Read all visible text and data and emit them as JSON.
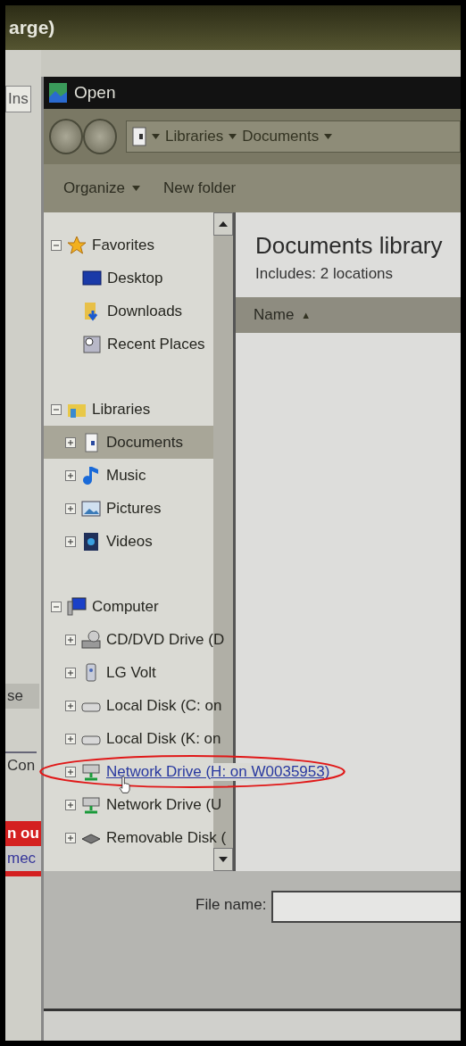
{
  "background_window": {
    "title": "arge)",
    "fragments": [
      {
        "text": "Ins",
        "kind": "field"
      },
      {
        "text": "se",
        "kind": "button"
      },
      {
        "text": "Con",
        "kind": "tab"
      },
      {
        "text": "n ou",
        "kind": "alert"
      },
      {
        "text": "mec",
        "kind": "alert"
      }
    ]
  },
  "dialog": {
    "title": "Open",
    "breadcrumb": [
      "Libraries",
      "Documents"
    ],
    "toolbar": {
      "organize": "Organize",
      "new_folder": "New folder"
    },
    "tree": [
      {
        "label": "Favorites",
        "kind": "star",
        "expanded": true,
        "children": [
          {
            "label": "Desktop",
            "kind": "desktop",
            "selected": false
          },
          {
            "label": "Downloads",
            "kind": "downloads",
            "selected": false
          },
          {
            "label": "Recent Places",
            "kind": "recent",
            "selected": false
          }
        ]
      },
      {
        "label": "Libraries",
        "kind": "libraries",
        "expanded": true,
        "children": [
          {
            "label": "Documents",
            "kind": "document",
            "expanded": false,
            "selected": true
          },
          {
            "label": "Music",
            "kind": "music",
            "expanded": false,
            "selected": false
          },
          {
            "label": "Pictures",
            "kind": "pictures",
            "expanded": false,
            "selected": false
          },
          {
            "label": "Videos",
            "kind": "videos",
            "expanded": false,
            "selected": false
          }
        ]
      },
      {
        "label": "Computer",
        "kind": "computer",
        "expanded": true,
        "children": [
          {
            "label": "CD/DVD Drive (D",
            "kind": "cd",
            "expanded": false,
            "selected": false
          },
          {
            "label": "LG Volt",
            "kind": "phone",
            "expanded": false,
            "selected": false
          },
          {
            "label": "Local Disk (C: on",
            "kind": "disk",
            "expanded": false,
            "selected": false
          },
          {
            "label": "Local Disk (K: on",
            "kind": "disk",
            "expanded": false,
            "selected": false
          },
          {
            "label": "Network Drive (H: on W0035953)",
            "kind": "network",
            "expanded": false,
            "selected": false,
            "hovered": true
          },
          {
            "label": "Network Drive (U",
            "kind": "network",
            "expanded": false,
            "selected": false
          },
          {
            "label": "Removable Disk (",
            "kind": "removable",
            "expanded": false,
            "selected": false
          }
        ]
      }
    ],
    "library": {
      "title": "Documents library",
      "includes": "Includes:  2 locations",
      "column": "Name",
      "sort": "▲"
    },
    "file_name": {
      "label": "File name:"
    }
  }
}
